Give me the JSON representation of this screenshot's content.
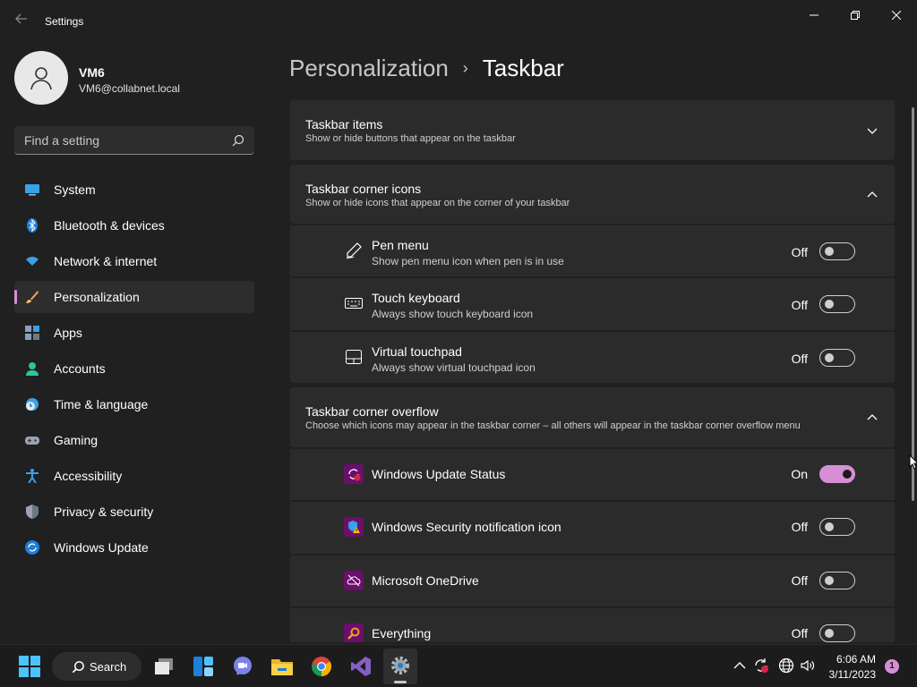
{
  "window": {
    "title": "Settings",
    "back_icon": "arrow-left-icon",
    "controls": [
      "minimize-icon",
      "restore-icon",
      "close-icon"
    ]
  },
  "user": {
    "name": "VM6",
    "email": "VM6@collabnet.local",
    "avatar_icon": "person-icon"
  },
  "search": {
    "placeholder": "Find a setting",
    "icon": "search-icon"
  },
  "nav": {
    "selected": "Personalization",
    "items": [
      {
        "label": "System",
        "icon": "monitor-icon"
      },
      {
        "label": "Bluetooth & devices",
        "icon": "bluetooth-icon"
      },
      {
        "label": "Network & internet",
        "icon": "wifi-icon"
      },
      {
        "label": "Personalization",
        "icon": "brush-icon"
      },
      {
        "label": "Apps",
        "icon": "apps-icon"
      },
      {
        "label": "Accounts",
        "icon": "account-icon"
      },
      {
        "label": "Time & language",
        "icon": "clock-globe-icon"
      },
      {
        "label": "Gaming",
        "icon": "gamepad-icon"
      },
      {
        "label": "Accessibility",
        "icon": "accessibility-icon"
      },
      {
        "label": "Privacy & security",
        "icon": "shield-icon"
      },
      {
        "label": "Windows Update",
        "icon": "update-icon"
      }
    ]
  },
  "breadcrumb": {
    "parent": "Personalization",
    "separator": "›",
    "current": "Taskbar"
  },
  "sections": [
    {
      "title": "Taskbar items",
      "subtitle": "Show or hide buttons that appear on the taskbar",
      "expanded": false
    },
    {
      "title": "Taskbar corner icons",
      "subtitle": "Show or hide icons that appear on the corner of your taskbar",
      "expanded": true,
      "rows": [
        {
          "title": "Pen menu",
          "subtitle": "Show pen menu icon when pen is in use",
          "state": "Off",
          "on": false,
          "icon": "pen-icon"
        },
        {
          "title": "Touch keyboard",
          "subtitle": "Always show touch keyboard icon",
          "state": "Off",
          "on": false,
          "icon": "keyboard-icon"
        },
        {
          "title": "Virtual touchpad",
          "subtitle": "Always show virtual touchpad icon",
          "state": "Off",
          "on": false,
          "icon": "touchpad-icon"
        }
      ]
    },
    {
      "title": "Taskbar corner overflow",
      "subtitle": "Choose which icons may appear in the taskbar corner – all others will appear in the taskbar corner overflow menu",
      "expanded": true,
      "rows": [
        {
          "title": "Windows Update Status",
          "state": "On",
          "on": true,
          "icon": "windows-update-status-icon"
        },
        {
          "title": "Windows Security notification icon",
          "state": "Off",
          "on": false,
          "icon": "security-warning-icon"
        },
        {
          "title": "Microsoft OneDrive",
          "state": "Off",
          "on": false,
          "icon": "onedrive-icon"
        },
        {
          "title": "Everything",
          "state": "Off",
          "on": false,
          "icon": "everything-search-icon"
        }
      ]
    }
  ],
  "taskbar": {
    "search_label": "Search",
    "apps": [
      "windows-start-icon",
      "search-icon",
      "task-view-icon",
      "widgets-icon",
      "teams-chat-icon",
      "file-explorer-icon",
      "chrome-icon",
      "visual-studio-icon",
      "settings-icon"
    ],
    "tray": [
      "chevron-up-icon",
      "update-status-icon",
      "globe-icon",
      "volume-icon"
    ],
    "time": "6:06 AM",
    "date": "3/11/2023",
    "notification_count": "1"
  },
  "colors": {
    "accent": "#d68fd6",
    "background": "#202020",
    "card": "#2b2b2b",
    "app_icon_bg": "#6a0f6a"
  }
}
